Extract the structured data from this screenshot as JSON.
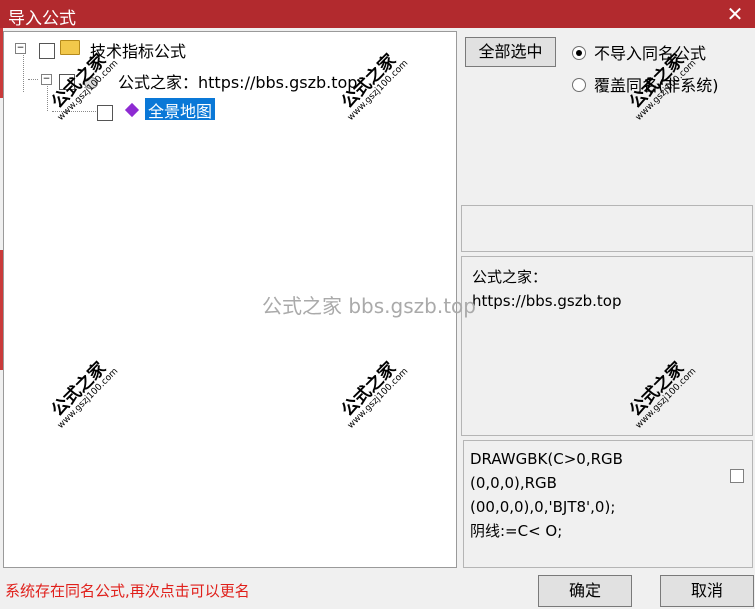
{
  "window": {
    "title": "导入公式",
    "close_label": "✕"
  },
  "tree": {
    "root_label": "技术指标公式",
    "source_label": "公式之家：https://bbs.gszb.top",
    "formula_label": "全景地图"
  },
  "options": {
    "select_all_label": "全部选中",
    "radio_no_import": "不导入同名公式",
    "radio_overwrite": "覆盖同名(非系统)",
    "selected": "no_import"
  },
  "description": {
    "line1": "公式之家：",
    "line2": "https://bbs.gszb.top"
  },
  "code": {
    "line1": "DRAWGBK(C>0,RGB",
    "line2": "(0,0,0),RGB",
    "line3": "(00,0,0),0,'BJT8',0);",
    "line4": "阴线:=C< O;"
  },
  "status": "系统存在同名公式,再次点击可以更名",
  "buttons": {
    "ok_label": "确定",
    "cancel_label": "取消"
  },
  "watermark": {
    "center_text": "公式之家 bbs.gszb.top",
    "stamp_cn": "公式之家",
    "stamp_en": "www.gszj100.com"
  },
  "colors": {
    "titlebar": "#b22a2e",
    "selection": "#0a78d7",
    "status_text": "#e0201b"
  }
}
